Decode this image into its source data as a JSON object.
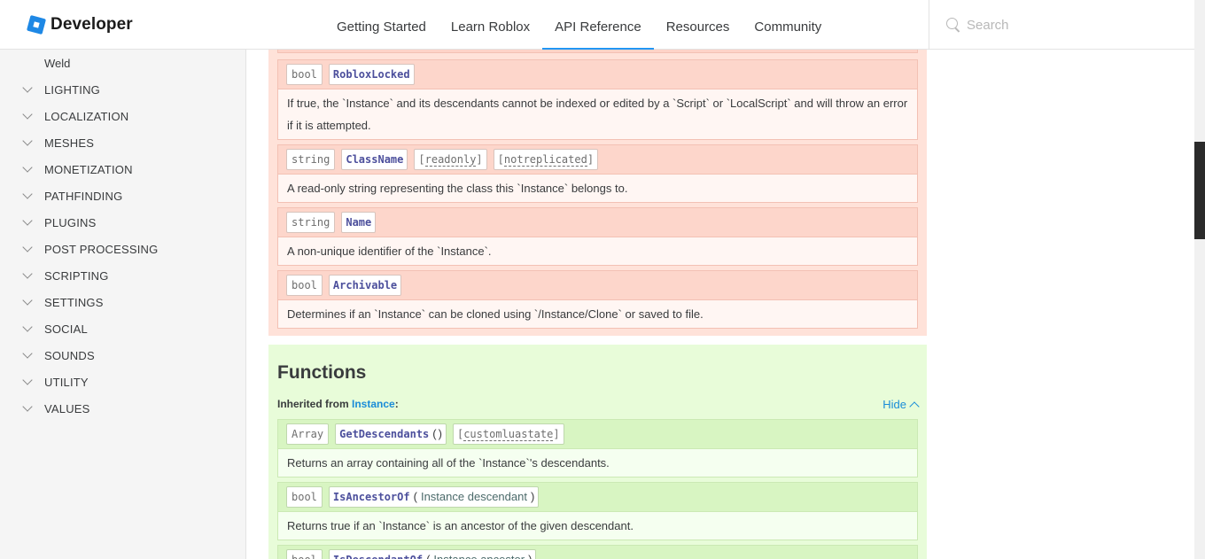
{
  "header": {
    "logo_text": "Developer",
    "nav": [
      "Getting Started",
      "Learn Roblox",
      "API Reference",
      "Resources",
      "Community"
    ],
    "active_nav": "API Reference",
    "search_placeholder": "Search"
  },
  "sidebar": {
    "sub_item": "Weld",
    "items": [
      "LIGHTING",
      "LOCALIZATION",
      "MESHES",
      "MONETIZATION",
      "PATHFINDING",
      "PLUGINS",
      "POST PROCESSING",
      "SCRIPTING",
      "SETTINGS",
      "SOCIAL",
      "SOUNDS",
      "UTILITY",
      "VALUES"
    ]
  },
  "properties": [
    {
      "type": "bool",
      "name": "RobloxLocked",
      "tags": [],
      "description": "If true, the `Instance` and its descendants cannot be indexed or edited by a `Script` or `LocalScript` and will throw an error if it is attempted."
    },
    {
      "type": "string",
      "name": "ClassName",
      "tags": [
        "readonly",
        "notreplicated"
      ],
      "description": "A read-only string representing the class this `Instance` belongs to."
    },
    {
      "type": "string",
      "name": "Name",
      "tags": [],
      "description": "A non-unique identifier of the `Instance`."
    },
    {
      "type": "bool",
      "name": "Archivable",
      "tags": [],
      "description": "Determines if an `Instance` can be cloned using `/Instance/Clone` or saved to file."
    }
  ],
  "functions_section": {
    "title": "Functions",
    "inherited_label": "Inherited from",
    "inherited_class": "Instance",
    "inherited_colon": ":",
    "hide_label": "Hide",
    "items": [
      {
        "type": "Array",
        "name": "GetDescendants",
        "open_paren": "(",
        "params": "",
        "close_paren": ")",
        "tag": "customluastate",
        "description": "Returns an array containing all of the `Instance`'s descendants."
      },
      {
        "type": "bool",
        "name": "IsAncestorOf",
        "open_paren": "(",
        "param_type": "Instance",
        "param_name": "descendant",
        "close_paren": ")",
        "description": "Returns true if an `Instance` is an ancestor of the given descendant."
      },
      {
        "type": "bool",
        "name": "IsDescendantOf",
        "open_paren": "(",
        "param_type": "Instance",
        "param_name": "ancestor",
        "close_paren": ")"
      }
    ]
  },
  "colors": {
    "accent": "#2196f3",
    "link": "#1a8cd8",
    "property_panel": "#ffe2d9",
    "function_panel": "#e8fcd9"
  }
}
